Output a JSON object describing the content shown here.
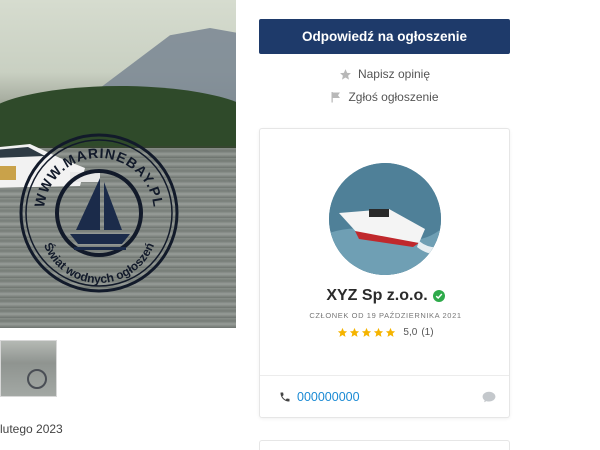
{
  "listing": {
    "photo_alt": "boat photo",
    "watermark": {
      "text_top": "WWW.MARINEBAY.PL",
      "text_bottom": "Świat wodnych ogłoszeń"
    },
    "date_partial": "lutego 2023"
  },
  "actions": {
    "reply_label": "Odpowiedź na ogłoszenie",
    "review_label": "Napisz opinię",
    "report_label": "Zgłoś ogłoszenie"
  },
  "seller": {
    "name": "XYZ Sp z.o.o.",
    "verified": true,
    "member_since": "CZŁONEK OD 19 PAŹDZIERNIKA 2021",
    "rating_value": "5,0",
    "rating_count": "(1)",
    "stars": 5,
    "phone": "000000000"
  },
  "colors": {
    "primary_button": "#1e3a6a",
    "link": "#1a8ad4",
    "star": "#f5b400",
    "verified": "#2eaa4a"
  },
  "icons": {
    "review": "star-icon",
    "report": "flag-icon",
    "phone": "phone-icon",
    "chat": "chat-bubble-icon"
  }
}
